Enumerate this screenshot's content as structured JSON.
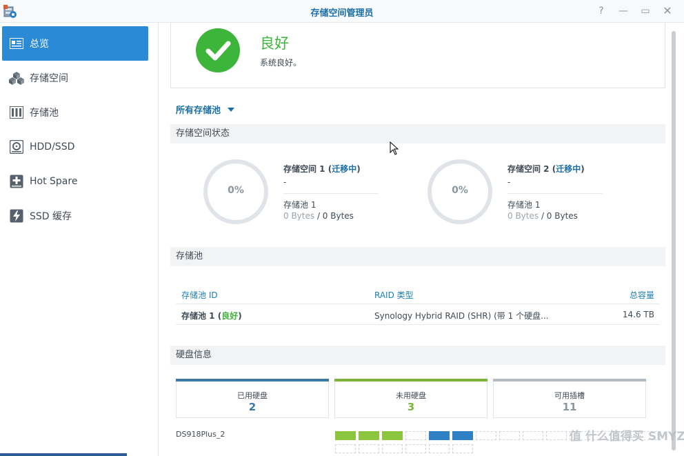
{
  "window": {
    "title": "存储空间管理员",
    "help_label": "?",
    "min_label": "—",
    "max_label": "▭",
    "close_label": "✕"
  },
  "sidebar": {
    "items": [
      {
        "label": "总览",
        "icon": "overview-icon"
      },
      {
        "label": "存储空间",
        "icon": "volume-cubes-icon"
      },
      {
        "label": "存储池",
        "icon": "storage-pool-icon"
      },
      {
        "label": "HDD/SSD",
        "icon": "hdd-icon"
      },
      {
        "label": "Hot Spare",
        "icon": "hot-spare-icon"
      },
      {
        "label": "SSD 缓存",
        "icon": "ssd-cache-icon"
      }
    ],
    "active_index": 0
  },
  "health": {
    "status": "良好",
    "description": "系统良好。",
    "color": "#3db43a"
  },
  "filter": {
    "label": "所有存储池"
  },
  "volume_status": {
    "heading": "存储空间状态",
    "volumes": [
      {
        "name": "存储空间 1",
        "state": "迁移中",
        "usage": "0%",
        "dash": "-",
        "pool": "存储池 1",
        "used": "0 Bytes",
        "total": "/ 0 Bytes"
      },
      {
        "name": "存储空间 2",
        "state": "迁移中",
        "usage": "0%",
        "dash": "-",
        "pool": "存储池 1",
        "used": "0 Bytes",
        "total": "/ 0 Bytes"
      }
    ]
  },
  "storage_pool": {
    "heading": "存储池",
    "columns": [
      "存储池 ID",
      "RAID 类型",
      "总容量"
    ],
    "rows": [
      {
        "id": "存储池 1",
        "status": "良好",
        "raid": "Synology Hybrid RAID (SHR) (带 1 个硬盘...",
        "capacity": "14.6 TB"
      }
    ]
  },
  "disk_info": {
    "heading": "硬盘信息",
    "cards": [
      {
        "label": "已用硬盘",
        "value": "2",
        "color": "#3a79a6"
      },
      {
        "label": "未用硬盘",
        "value": "3",
        "color": "#7cb53b"
      },
      {
        "label": "可用插槽",
        "value": "11",
        "color": "#8c959d"
      }
    ],
    "nas_name": "DS918Plus_2",
    "slots": [
      "unused",
      "unused",
      "unused",
      "free",
      "used",
      "used",
      "free",
      "free",
      "free",
      "free",
      "free",
      "free",
      "free",
      "free",
      "free",
      "free",
      "free",
      "free",
      "free",
      "free"
    ]
  },
  "watermark": "值 什么值得买 SMYZ.NET"
}
